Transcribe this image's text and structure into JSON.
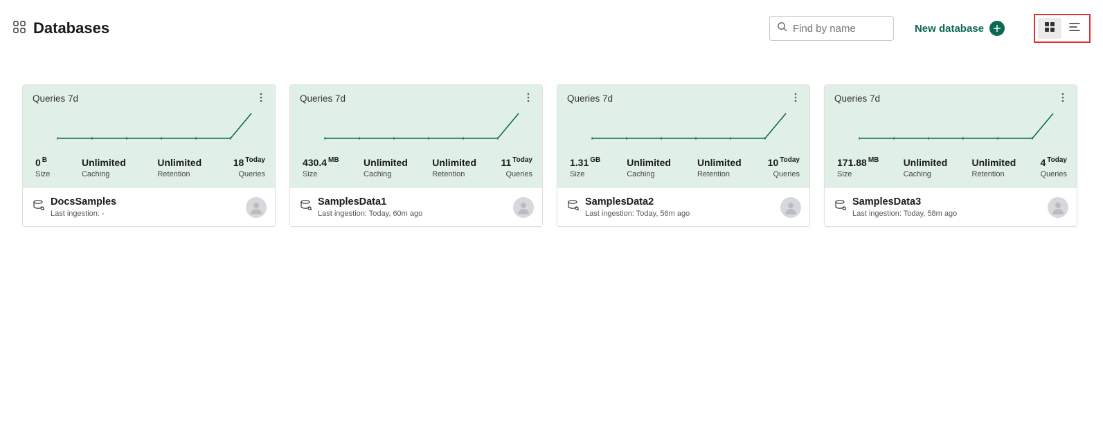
{
  "header": {
    "title": "Databases",
    "search_placeholder": "Find by name",
    "new_database_label": "New database"
  },
  "chart_label": "Queries 7d",
  "stat_labels": {
    "size": "Size",
    "caching": "Caching",
    "retention": "Retention",
    "queries": "Queries",
    "today": "Today"
  },
  "common": {
    "unlimited": "Unlimited"
  },
  "databases": [
    {
      "name": "DocsSamples",
      "size_value": "0",
      "size_unit": "B",
      "caching": "Unlimited",
      "retention": "Unlimited",
      "queries_today": "18",
      "ingestion": "Last ingestion: -"
    },
    {
      "name": "SamplesData1",
      "size_value": "430.4",
      "size_unit": "MB",
      "caching": "Unlimited",
      "retention": "Unlimited",
      "queries_today": "11",
      "ingestion": "Last ingestion: Today, 60m ago"
    },
    {
      "name": "SamplesData2",
      "size_value": "1.31",
      "size_unit": "GB",
      "caching": "Unlimited",
      "retention": "Unlimited",
      "queries_today": "10",
      "ingestion": "Last ingestion: Today, 56m ago"
    },
    {
      "name": "SamplesData3",
      "size_value": "171.88",
      "size_unit": "MB",
      "caching": "Unlimited",
      "retention": "Unlimited",
      "queries_today": "4",
      "ingestion": "Last ingestion: Today, 58m ago"
    }
  ],
  "chart_data": {
    "type": "line",
    "x": [
      0,
      1,
      2,
      3,
      4,
      5,
      6
    ],
    "values": [
      0,
      0,
      0,
      0,
      0,
      0,
      10
    ],
    "ylim": [
      0,
      12
    ],
    "title": "Queries 7d"
  }
}
